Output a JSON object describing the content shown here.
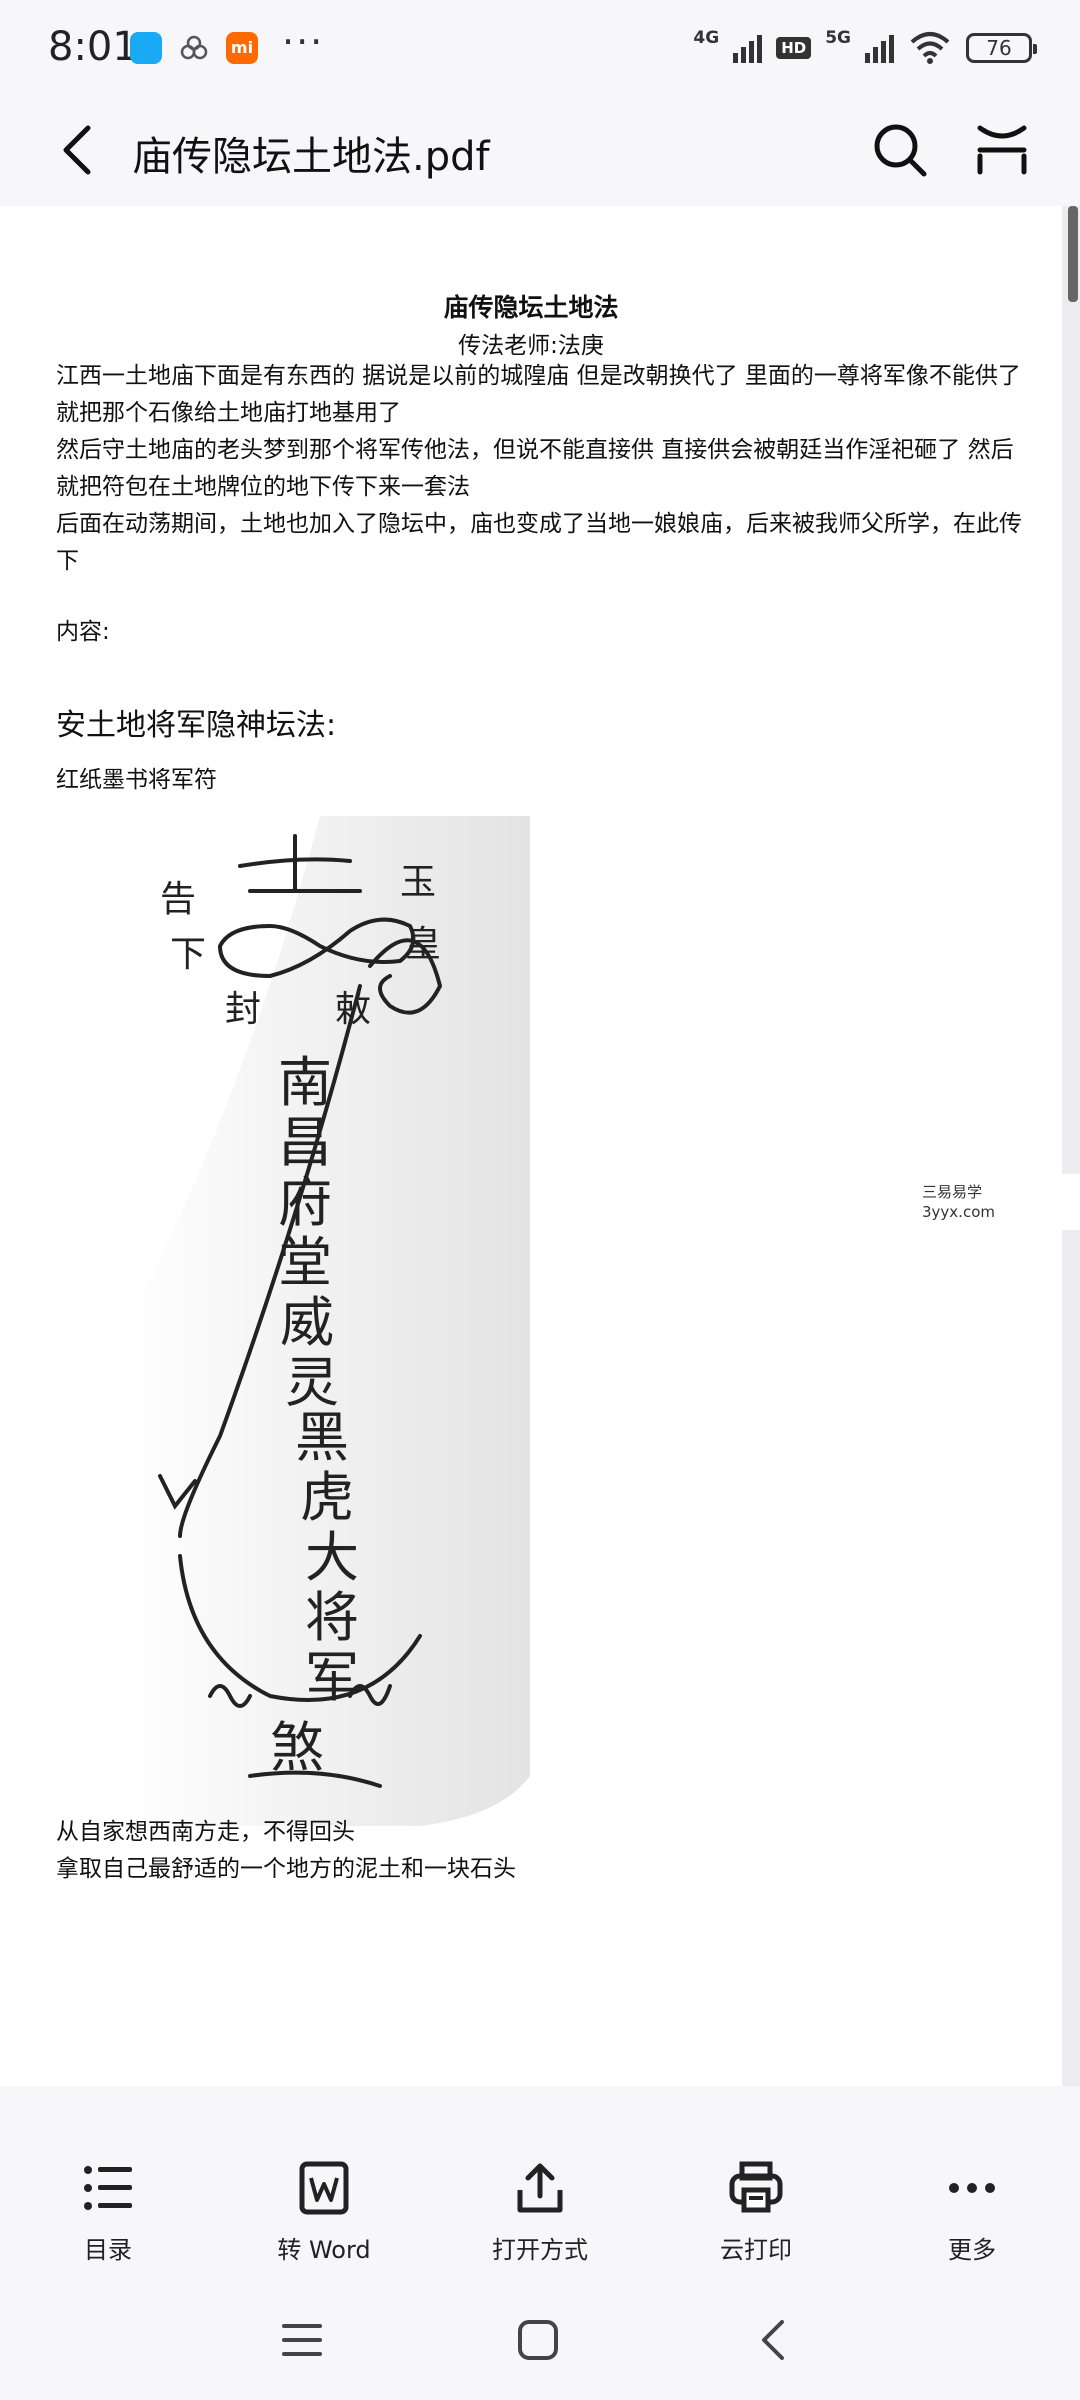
{
  "status_bar": {
    "time": "8:01",
    "net1": "4G",
    "net2": "5G",
    "hd": "HD",
    "battery": "76",
    "mi_label": "mi",
    "more": "···"
  },
  "header": {
    "title": "庙传隐坛土地法.pdf"
  },
  "document": {
    "title": "庙传隐坛土地法",
    "subtitle": "传法老师:法庚",
    "intro_1": "江西一土地庙下面是有东西的 据说是以前的城隍庙 但是改朝换代了 里面的一尊将军像不能供了 就把那个石像给土地庙打地基用了",
    "intro_2": "然后守土地庙的老头梦到那个将军传他法，但说不能直接供 直接供会被朝廷当作淫祀砸了 然后就把符包在土地牌位的地下传下来一套法",
    "intro_3": "后面在动荡期间，土地也加入了隐坛中，庙也变成了当地一娘娘庙，后来被我师父所学，在此传下",
    "content_label": "内容:",
    "section_title": "安土地将军隐神坛法:",
    "talisman_caption": "红纸墨书将军符",
    "talisman_chars": [
      "告",
      "下",
      "玉",
      "皇",
      "封",
      "敕",
      "南",
      "昌",
      "府",
      "堂",
      "威",
      "灵",
      "黑",
      "虎",
      "大",
      "将",
      "军",
      "煞"
    ],
    "instruction_1": "从自家想西南方走，不得回头",
    "instruction_2": "拿取自己最舒适的一个地方的泥土和一块石头",
    "watermark_line1": "三易易学",
    "watermark_line2": "3yyx.com"
  },
  "toolbar": [
    {
      "label": "目录",
      "icon": "list-icon"
    },
    {
      "label": "转 Word",
      "icon": "word-icon"
    },
    {
      "label": "打开方式",
      "icon": "share-icon"
    },
    {
      "label": "云打印",
      "icon": "printer-icon"
    },
    {
      "label": "更多",
      "icon": "more-icon"
    }
  ]
}
